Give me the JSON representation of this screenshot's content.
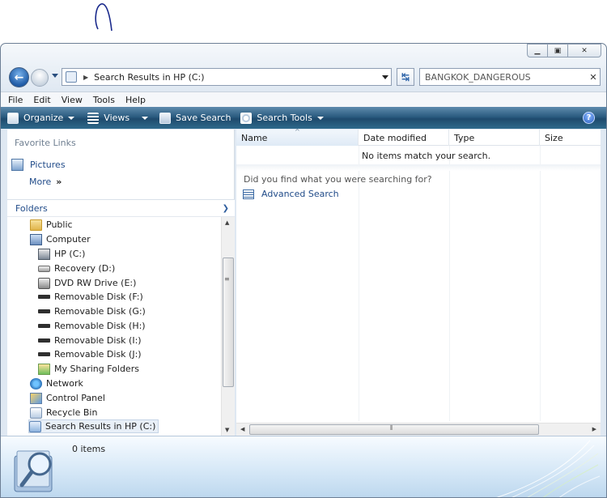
{
  "window": {
    "caption_buttons": [
      "minimize",
      "maximize",
      "close"
    ]
  },
  "address": {
    "path": "Search Results in HP (C:)",
    "search_value": "BANGKOK_DANGEROUS"
  },
  "menu": [
    "File",
    "Edit",
    "View",
    "Tools",
    "Help"
  ],
  "toolbar": {
    "organize": "Organize",
    "views": "Views",
    "save_search": "Save Search",
    "search_tools": "Search Tools"
  },
  "nav": {
    "favorite_links_title": "Favorite Links",
    "favorites": [
      "Pictures",
      "More"
    ],
    "more_glyph": "»",
    "folders_title": "Folders",
    "tree": [
      {
        "label": "Public",
        "icon": "folder-icon"
      },
      {
        "label": "Computer",
        "icon": "computer-icon"
      },
      {
        "label": "HP (C:)",
        "icon": "hard-drive-icon"
      },
      {
        "label": "Recovery (D:)",
        "icon": "drive-icon"
      },
      {
        "label": "DVD RW Drive (E:)",
        "icon": "dvd-drive-icon"
      },
      {
        "label": "Removable Disk (F:)",
        "icon": "removable-disk-icon"
      },
      {
        "label": "Removable Disk (G:)",
        "icon": "removable-disk-icon"
      },
      {
        "label": "Removable Disk (H:)",
        "icon": "removable-disk-icon"
      },
      {
        "label": "Removable Disk (I:)",
        "icon": "removable-disk-icon"
      },
      {
        "label": "Removable Disk (J:)",
        "icon": "removable-disk-icon"
      },
      {
        "label": "My Sharing Folders",
        "icon": "sharing-folder-icon"
      },
      {
        "label": "Network",
        "icon": "network-icon"
      },
      {
        "label": "Control Panel",
        "icon": "control-panel-icon"
      },
      {
        "label": "Recycle Bin",
        "icon": "recycle-bin-icon"
      },
      {
        "label": "Search Results in HP (C:)",
        "icon": "search-results-icon"
      }
    ]
  },
  "columns": [
    "Name",
    "Date modified",
    "Type",
    "Size"
  ],
  "content": {
    "empty_message": "No items match your search.",
    "did_you_find": "Did you find what you were searching for?",
    "advanced_search": "Advanced Search"
  },
  "details": {
    "count": "0 items"
  },
  "colors": {
    "toolbar": "#2b5c80",
    "link": "#1f4a88"
  }
}
